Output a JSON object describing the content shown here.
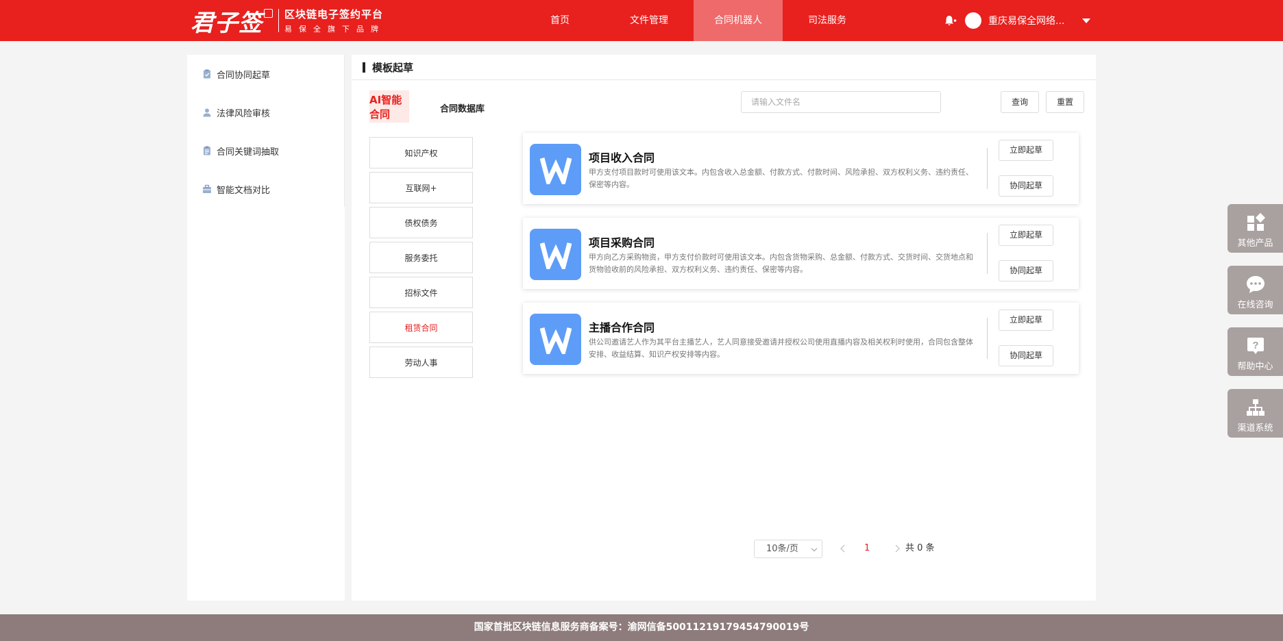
{
  "brand": {
    "logo_mark": "君子签",
    "platform_name": "区块链电子签约平台",
    "slogan": "易保全旗下品牌"
  },
  "nav": {
    "items": [
      {
        "label": "首页"
      },
      {
        "label": "文件管理"
      },
      {
        "label": "合同机器人"
      },
      {
        "label": "司法服务"
      }
    ],
    "active_label": "合同机器人"
  },
  "user": {
    "name": "重庆易保全网络...",
    "bell_icon": "bell-icon"
  },
  "sidebar": {
    "items": [
      {
        "label": "合同协同起草",
        "icon": "clipboard-check-icon"
      },
      {
        "label": "法律风险审核",
        "icon": "person-icon"
      },
      {
        "label": "合同关键词抽取",
        "icon": "clipboard-list-icon"
      },
      {
        "label": "智能文档对比",
        "icon": "briefcase-icon"
      }
    ]
  },
  "main": {
    "title": "模板起草",
    "tabs": {
      "ai": "AI智能合同",
      "db": "合同数据库"
    },
    "search": {
      "placeholder": "请输入文件名",
      "value": ""
    },
    "query_label": "查询",
    "reset_label": "重置",
    "categories": [
      "知识产权",
      "互联网+",
      "债权债务",
      "服务委托",
      "招标文件",
      "租赁合同",
      "劳动人事"
    ],
    "active_category": "租赁合同",
    "cards": [
      {
        "title": "项目收入合同",
        "desc": "甲方支付项目款时可使用该文本。内包含收入总金额、付款方式、付款时间、风险承担、双方权利义务、违约责任、保密等内容。",
        "draft_label": "立即起草",
        "collab_label": "协同起草"
      },
      {
        "title": "项目采购合同",
        "desc": "甲方向乙方采购物资，甲方支付价款时可使用该文本。内包含货物采购、总金额、付款方式、交货时间、交货地点和货物验收前的风险承担、双方权利义务、违约责任、保密等内容。",
        "draft_label": "立即起草",
        "collab_label": "协同起草"
      },
      {
        "title": "主播合作合同",
        "desc": "供公司邀请艺人作为其平台主播艺人，艺人同意接受邀请并授权公司使用直播内容及相关权利时使用，合同包含整体安排、收益结算、知识产权安排等内容。",
        "draft_label": "立即起草",
        "collab_label": "协同起草"
      }
    ],
    "pagination": {
      "page_size": "10条/页",
      "current_page": "1",
      "total": "共 0 条"
    }
  },
  "float_menu": [
    {
      "label": "其他产品",
      "icon": "apps-icon"
    },
    {
      "label": "在线咨询",
      "icon": "chat-icon"
    },
    {
      "label": "帮助中心",
      "icon": "help-icon"
    },
    {
      "label": "渠道系统",
      "icon": "org-chart-icon"
    }
  ],
  "footer": {
    "text": "国家首批区块链信息服务商备案号：渝网信备50011219179454790019号"
  },
  "colors": {
    "brand_red": "#e8201e",
    "nav_active": "#ef6a6a",
    "card_icon_blue": "#5e9df7",
    "float_gray": "#a9a0a0",
    "footer_bg": "#8e7b7b"
  }
}
